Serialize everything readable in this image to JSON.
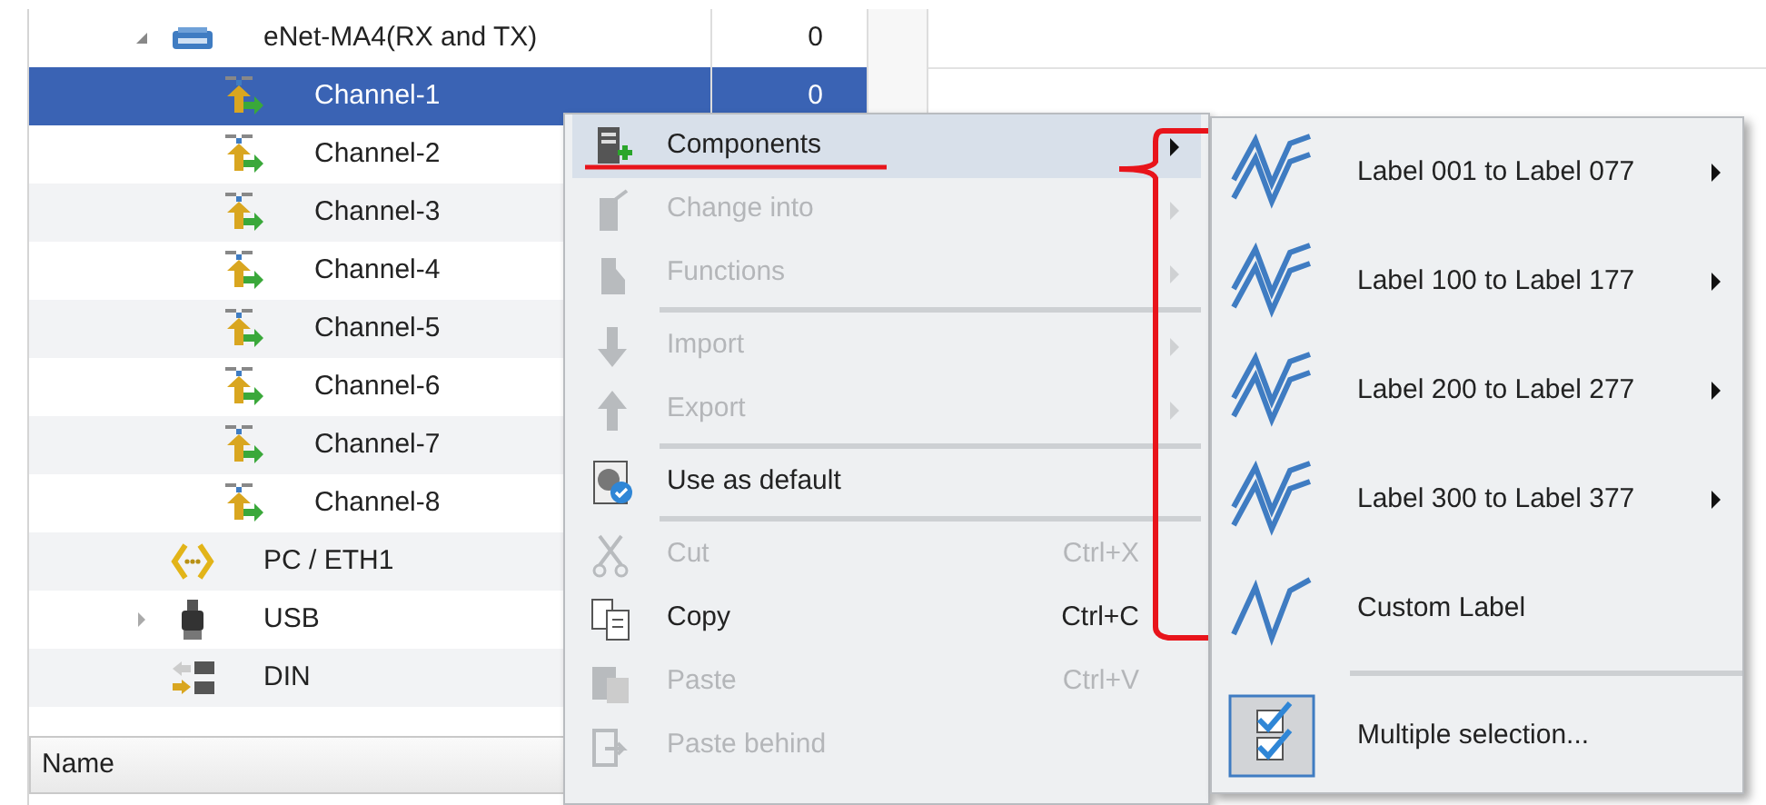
{
  "tree": {
    "items": [
      {
        "label": "eNet-MA4(RX and TX)",
        "value": "0",
        "kind": "device",
        "expanded": true,
        "selected": false,
        "children": [
          {
            "label": "Channel-1",
            "value": "0",
            "kind": "channel",
            "selected": true
          },
          {
            "label": "Channel-2",
            "kind": "channel",
            "selected": false
          },
          {
            "label": "Channel-3",
            "kind": "channel",
            "selected": false
          },
          {
            "label": "Channel-4",
            "kind": "channel",
            "selected": false
          },
          {
            "label": "Channel-5",
            "kind": "channel",
            "selected": false
          },
          {
            "label": "Channel-6",
            "kind": "channel",
            "selected": false
          },
          {
            "label": "Channel-7",
            "kind": "channel",
            "selected": false
          },
          {
            "label": "Channel-8",
            "kind": "channel",
            "selected": false
          }
        ]
      },
      {
        "label": "PC / ETH1",
        "kind": "braces",
        "selected": false
      },
      {
        "label": "USB",
        "kind": "usb",
        "expanded": false,
        "selected": false
      },
      {
        "label": "DIN",
        "kind": "din",
        "selected": false
      }
    ]
  },
  "column_header": {
    "label": "Name"
  },
  "context_menu": {
    "items": [
      {
        "kind": "components",
        "label": "Components",
        "disabled": false,
        "submenu": true,
        "selected": true
      },
      {
        "kind": "change",
        "label": "Change into",
        "disabled": true,
        "submenu": true,
        "selected": false
      },
      {
        "kind": "functions",
        "label": "Functions",
        "disabled": true,
        "submenu": true,
        "selected": false
      },
      {
        "kind": "separator"
      },
      {
        "kind": "import",
        "label": "Import",
        "disabled": true,
        "submenu": true,
        "selected": false
      },
      {
        "kind": "export",
        "label": "Export",
        "disabled": true,
        "submenu": true,
        "selected": false
      },
      {
        "kind": "separator"
      },
      {
        "kind": "default",
        "label": "Use as default",
        "disabled": false,
        "submenu": false,
        "selected": false
      },
      {
        "kind": "separator"
      },
      {
        "kind": "cut",
        "label": "Cut",
        "shortcut": "Ctrl+X",
        "disabled": true,
        "submenu": false,
        "selected": false
      },
      {
        "kind": "copy",
        "label": "Copy",
        "shortcut": "Ctrl+C",
        "disabled": false,
        "submenu": false,
        "selected": false
      },
      {
        "kind": "paste",
        "label": "Paste",
        "shortcut": "Ctrl+V",
        "disabled": true,
        "submenu": false,
        "selected": false
      },
      {
        "kind": "pastebehind",
        "label": "Paste behind",
        "disabled": true,
        "submenu": false,
        "selected": false
      }
    ]
  },
  "submenu": {
    "items": [
      {
        "kind": "wave2",
        "label": "Label 001 to Label 077",
        "submenu": true
      },
      {
        "kind": "wave2",
        "label": "Label 100 to Label 177",
        "submenu": true
      },
      {
        "kind": "wave2",
        "label": "Label 200 to Label 277",
        "submenu": true
      },
      {
        "kind": "wave2",
        "label": "Label 300 to Label 377",
        "submenu": true
      },
      {
        "kind": "wave1",
        "label": "Custom Label",
        "submenu": false
      },
      {
        "kind": "separator"
      },
      {
        "kind": "multi",
        "label": "Multiple selection...",
        "submenu": false
      }
    ]
  }
}
